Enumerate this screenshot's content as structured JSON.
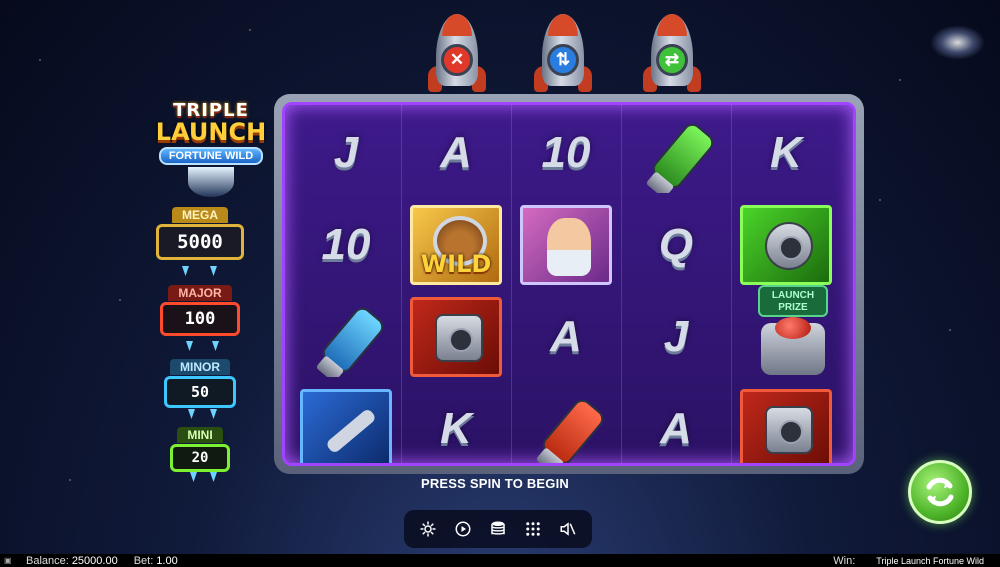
{
  "rockets": [
    {
      "symbol": "✕",
      "color": "#e0392a"
    },
    {
      "symbol": "⇅",
      "color": "#2a7de0"
    },
    {
      "symbol": "⇄",
      "color": "#3fc23a"
    }
  ],
  "logo": {
    "line1": "TRIPLE",
    "line2": "LAUNCH",
    "line3": "FORTUNE WILD"
  },
  "jackpots": {
    "mega": {
      "label": "MEGA",
      "value": "5000"
    },
    "major": {
      "label": "MAJOR",
      "value": "100"
    },
    "minor": {
      "label": "MINOR",
      "value": "50"
    },
    "mini": {
      "label": "MINI",
      "value": "20"
    }
  },
  "reels": {
    "rows": [
      [
        "J",
        "A",
        "10",
        "green-cylinder",
        "K"
      ],
      [
        "10",
        "WILD",
        "scientist",
        "Q",
        "green-device"
      ],
      [
        "blue-cylinder",
        "red-device",
        "A",
        "J",
        "launch-prize"
      ],
      [
        "wrench",
        "K",
        "red-cylinder",
        "A",
        "red-device"
      ]
    ],
    "wild_label": "WILD",
    "launch_prize_label": "LAUNCH PRIZE"
  },
  "message": "PRESS SPIN TO BEGIN",
  "controls": [
    {
      "name": "settings-icon"
    },
    {
      "name": "autoplay-icon"
    },
    {
      "name": "bet-stack-icon"
    },
    {
      "name": "menu-grid-icon"
    },
    {
      "name": "sound-muted-icon"
    }
  ],
  "status": {
    "balance_label": "Balance:",
    "balance_value": "25000.00",
    "bet_label": "Bet:",
    "bet_value": "1.00",
    "win_label": "Win:",
    "game_title": "Triple Launch Fortune Wild"
  },
  "colors": {
    "accent_purple": "#a144ff",
    "spin_green": "#4fb52a"
  }
}
